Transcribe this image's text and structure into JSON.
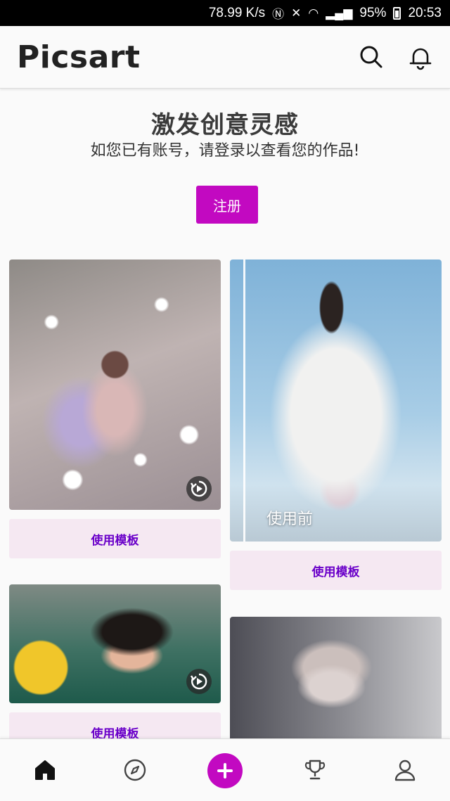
{
  "status_bar": {
    "speed": "78.99 K/s",
    "battery": "95%",
    "time": "20:53"
  },
  "header": {
    "logo": "Picsart",
    "search_icon": "search-icon",
    "bell_icon": "bell-icon"
  },
  "hero": {
    "title": "激发创意灵感",
    "subtitle": "如您已有账号，请登录以查看您的作品!",
    "signup_label": "注册"
  },
  "cards": [
    {
      "image": "daisy-field-photo",
      "replay_icon": "replay-icon",
      "button_label": "使用模板"
    },
    {
      "image": "man-with-flowers-photo",
      "overlay_label": "使用前",
      "button_label": "使用模板"
    },
    {
      "image": "girl-devil-horns-photo",
      "replay_icon": "replay-icon",
      "button_label": "使用模板"
    },
    {
      "image": "cat-ears-photo"
    }
  ],
  "bottom_nav": {
    "items": [
      "home-icon",
      "discover-icon",
      "create-icon",
      "trophy-icon",
      "profile-icon"
    ],
    "accent_color": "#c209c1"
  }
}
